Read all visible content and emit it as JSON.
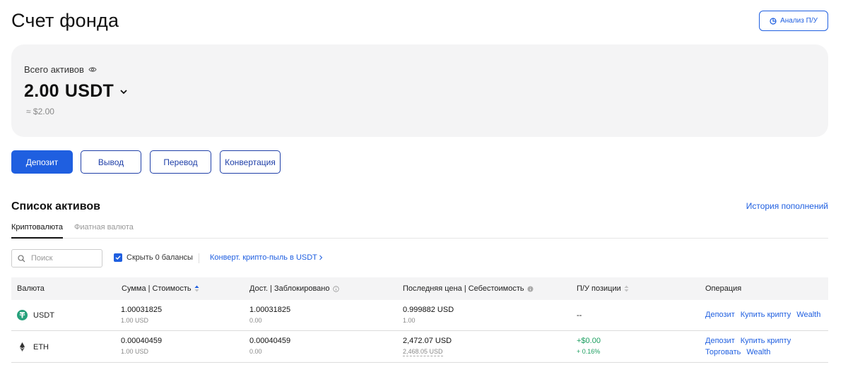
{
  "header": {
    "title": "Счет фонда",
    "pnl_button": "Анализ П/У"
  },
  "assets": {
    "label": "Всего активов",
    "amount": "2.00",
    "currency": "USDT",
    "approx": "≈ $2.00"
  },
  "actions": {
    "deposit": "Депозит",
    "withdraw": "Вывод",
    "transfer": "Перевод",
    "convert": "Конвертация"
  },
  "section": {
    "title": "Список активов",
    "history_link": "История пополнений"
  },
  "tabs": [
    "Криптовалюта",
    "Фиатная валюта"
  ],
  "filters": {
    "search_placeholder": "Поиск",
    "hide_zero": "Скрыть 0 балансы",
    "convert_link": "Конверт. крипто-пыль в USDT"
  },
  "table": {
    "headers": {
      "currency": "Валюта",
      "amount": "Сумма | Стоимость",
      "available": "Дост. | Заблокировано",
      "price": "Последняя цена | Себестоимость",
      "pnl": "П/У позиции",
      "operation": "Операция"
    },
    "rows": [
      {
        "coin": "USDT",
        "amount": "1.00031825",
        "amount_usd": "1.00 USD",
        "available": "1.00031825",
        "locked": "0.00",
        "last_price": "0.999882 USD",
        "cost": "1.00",
        "pnl": "--",
        "ops": [
          "Депозит",
          "Купить крипту",
          "Wealth"
        ]
      },
      {
        "coin": "ETH",
        "amount": "0.00040459",
        "amount_usd": "1.00 USD",
        "available": "0.00040459",
        "locked": "0.00",
        "last_price": "2,472.07 USD",
        "cost": "2,468.05 USD",
        "pnl": "+$0.00",
        "pnl_pct": "+ 0.16%",
        "ops": [
          "Депозит",
          "Купить крипту",
          "Торговать",
          "Wealth"
        ]
      }
    ]
  },
  "colors": {
    "accent": "#1f5fe0",
    "positive": "#1a9e5f",
    "usdt": "#26a17b"
  }
}
